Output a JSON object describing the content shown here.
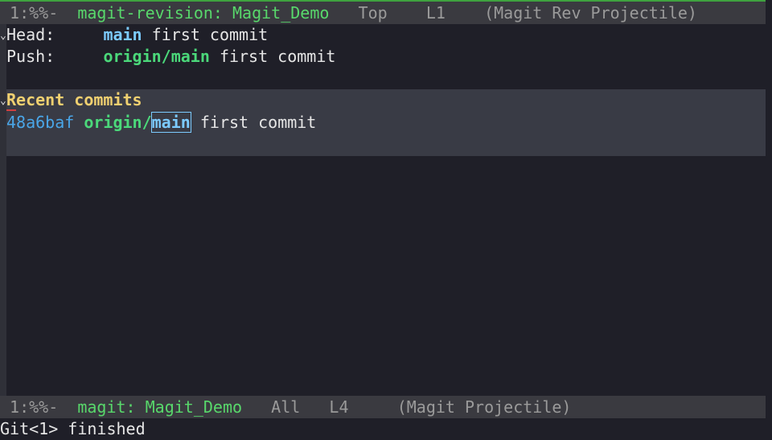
{
  "top_modeline": {
    "status": " 1:%%-  ",
    "buffer": "magit-revision: Magit_Demo",
    "position": "   Top   ",
    "line": " L1",
    "modes": "    (Magit Rev Projectile)"
  },
  "header": {
    "head_label": "Head:",
    "head_branch": "main",
    "head_message": "first commit",
    "push_label": "Push:",
    "push_branch": "origin/main",
    "push_message": "first commit"
  },
  "recent": {
    "title_first": "R",
    "title_rest": "ecent commits",
    "commit_hash": "48a6baf",
    "commit_remote_prefix": "origin/",
    "commit_local_branch": "main",
    "commit_message": "first commit"
  },
  "bottom_modeline": {
    "status": " 1:%%-  ",
    "buffer": "magit: Magit_Demo",
    "position": "   All   ",
    "line": "L4",
    "modes": "     (Magit Projectile)"
  },
  "echo": {
    "text": "Git<1> finished"
  },
  "colors": {
    "background": "#1f1f28",
    "section_highlight": "#393b45",
    "modeline": "#3a3a40",
    "local_branch": "#7ccbff",
    "remote_branch": "#4bd87a",
    "section_heading": "#f0d070",
    "commit_hash": "#4aa6e8"
  }
}
